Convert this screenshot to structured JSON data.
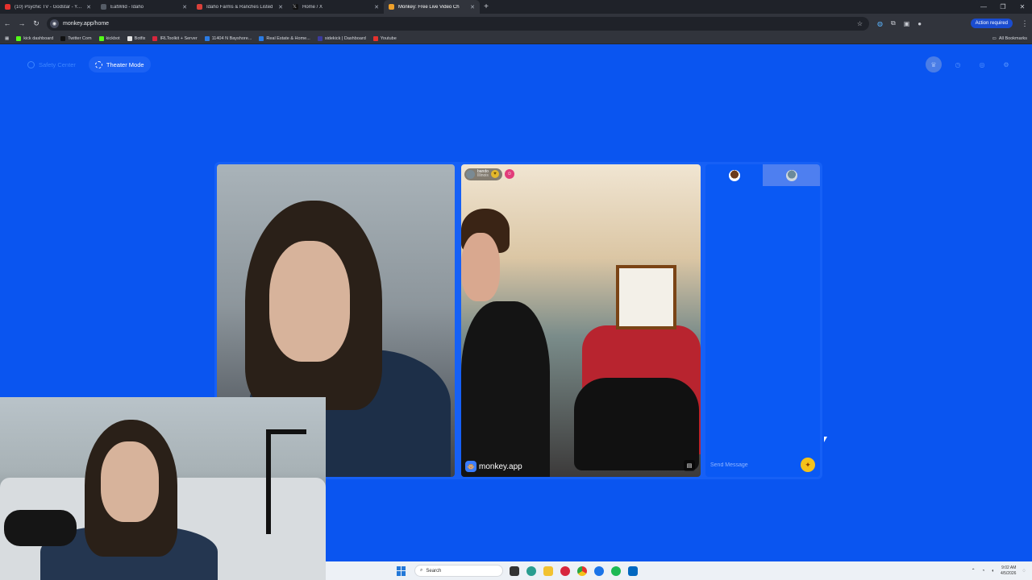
{
  "browser": {
    "tabs": [
      {
        "title": "(10) Psychic TV - Godstar - You",
        "color": "#e5312d"
      },
      {
        "title": "EatWild - Idaho",
        "color": "#555c66"
      },
      {
        "title": "Idaho Farms & Ranches Listed",
        "color": "#d9403a"
      },
      {
        "title": "Home / X",
        "color": "#111111"
      },
      {
        "title": "Monkey: Free Live Video Ch",
        "color": "#f0a12a"
      }
    ],
    "new_tab": "+",
    "url": "monkey.app/home",
    "action_button": "Action required",
    "bookmarks": [
      {
        "label": "kick dashboard",
        "color": "#53fc18"
      },
      {
        "label": "Twitter Com",
        "color": "#111111"
      },
      {
        "label": "kickbot",
        "color": "#53fc18"
      },
      {
        "label": "Botfix",
        "color": "#e5e5e5"
      },
      {
        "label": "IRLToolkit + Server",
        "color": "#d7263d"
      },
      {
        "label": "11404 N Bayshore...",
        "color": "#2a7be4"
      },
      {
        "label": "Real Estate & Home...",
        "color": "#2a7be4"
      },
      {
        "label": "sidekick | Dashboard",
        "color": "#3b3b9e"
      },
      {
        "label": "Youtube",
        "color": "#e5312d"
      }
    ],
    "all_bookmarks": "All Bookmarks"
  },
  "page": {
    "safety_label": "Safety Center",
    "theater_label": "Theater Mode",
    "peer_username": "bando",
    "peer_subtext": "Illinois",
    "watermark": "monkey.app",
    "chat_placeholder": "Send Message"
  },
  "taskbar": {
    "search_placeholder": "Search",
    "time": "9:02 AM",
    "date": "4/5/2026"
  }
}
